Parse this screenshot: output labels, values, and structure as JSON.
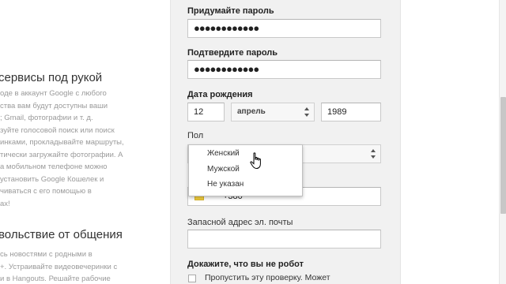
{
  "left": {
    "heading1": "сервисы под рукой",
    "para1": [
      "оде в аккаунт Google с любого",
      "ства вам будут доступны ваши",
      "; Gmail, фотографии и т. д.",
      "зуйте голосовой поиск или поиск",
      "инками, прокладывайте маршруты,",
      "тически загружайте фотографии. А",
      "а мобильном телефоне можно",
      "установить Google Кошелек и",
      "чиваться с его помощью в",
      "ах!"
    ],
    "heading2": "вольствие от общения",
    "para2": [
      "сь новостями с родными в",
      "+. Устраивайте видеовечеринки с",
      "и в Hangouts. Решайте рабочие"
    ]
  },
  "form": {
    "password_label": "Придумайте пароль",
    "password_value": "●●●●●●●●●●●●",
    "confirm_label": "Подтвердите пароль",
    "confirm_value": "●●●●●●●●●●●●",
    "birth_label": "Дата рождения",
    "birth_day": "12",
    "birth_month": "апрель",
    "birth_year": "1989",
    "gender_label": "Пол",
    "gender_options": [
      "Женский",
      "Мужской",
      "Не указан"
    ],
    "phone_prefix": "▾",
    "phone_value": "+380",
    "email_label": "Запасной адрес эл. почты",
    "email_value": "",
    "robot_label": "Докажите, что вы не робот",
    "robot_checkbox_label": "Пропустить эту проверку. Может"
  },
  "colors": {
    "form_background": "#f1f1f1",
    "scroll_thumb": "#c7c7c7"
  },
  "icons": {
    "cursor": "hand-pointer-icon",
    "flag": "ukraine-flag-icon"
  }
}
